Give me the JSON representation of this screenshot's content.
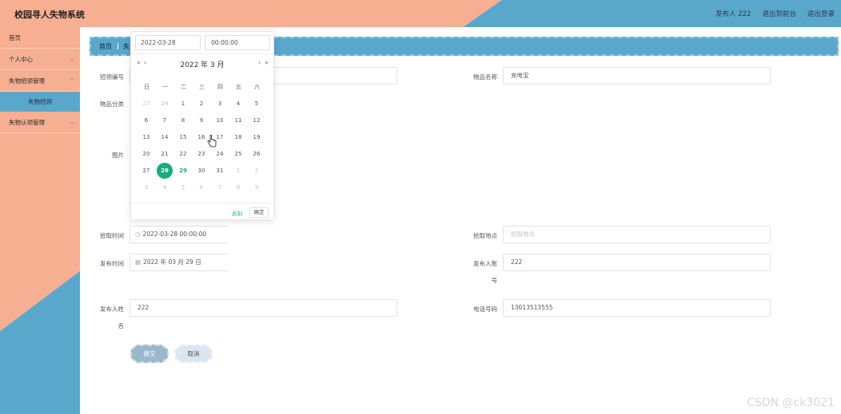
{
  "app": {
    "title": "校园寻人失物系统"
  },
  "header": {
    "publisher": "发布人 222",
    "back_to_front": "退出到前台",
    "logout": "退出登录"
  },
  "sidebar": {
    "items": [
      {
        "label": "首页"
      },
      {
        "label": "个人中心",
        "arrow": "⌄"
      },
      {
        "label": "失物招领管理",
        "arrow": "⌃",
        "sub": "失物招领"
      },
      {
        "label": "失物认领管理",
        "arrow": "⌄"
      }
    ]
  },
  "breadcrumb": {
    "home": "首页",
    "sep": "|",
    "current": "失"
  },
  "form": {
    "code_label": "招领编号",
    "name_label": "物品名称",
    "name_value": "充电宝",
    "category_label": "物品分类",
    "image_label": "图片",
    "pickup_time_label": "拾取时间",
    "pickup_time_value": "2022-03-28 00:00:00",
    "pickup_place_label": "拾取地点",
    "pickup_place_placeholder": "拾取地点",
    "publish_time_label": "发布时间",
    "publish_time_value": "2022 年 03 月 29 日",
    "publisher_account_label_1": "发布人账",
    "publisher_account_label_2": "号",
    "publisher_account_value": "222",
    "publisher_name_label_1": "发布人姓",
    "publisher_name_label_2": "名",
    "publisher_name_value": "222",
    "phone_label": "电话号码",
    "phone_value": "13013513555",
    "submit": "提交",
    "cancel": "取消"
  },
  "datepicker": {
    "date_value": "2022-03-28",
    "time_value": "00:00:00",
    "prev_year": "«",
    "prev_month": "‹",
    "next_month": "›",
    "next_year": "»",
    "title": "2022 年  3 月",
    "weekdays": [
      "日",
      "一",
      "二",
      "三",
      "四",
      "五",
      "六"
    ],
    "weeks": [
      [
        "27",
        "28",
        "1",
        "2",
        "3",
        "4",
        "5"
      ],
      [
        "6",
        "7",
        "8",
        "9",
        "10",
        "11",
        "12"
      ],
      [
        "13",
        "14",
        "15",
        "16",
        "17",
        "18",
        "19"
      ],
      [
        "20",
        "21",
        "22",
        "23",
        "24",
        "25",
        "26"
      ],
      [
        "27",
        "28",
        "29",
        "30",
        "31",
        "1",
        "2"
      ],
      [
        "3",
        "4",
        "5",
        "6",
        "7",
        "8",
        "9"
      ]
    ],
    "clear": "此刻",
    "ok": "确定",
    "accent": "#13ae7c"
  },
  "watermark": "CSDN @ck3021",
  "colors": {
    "salmon": "#f7af92",
    "blue": "#5aa7cc",
    "accent": "#13ae7c"
  }
}
